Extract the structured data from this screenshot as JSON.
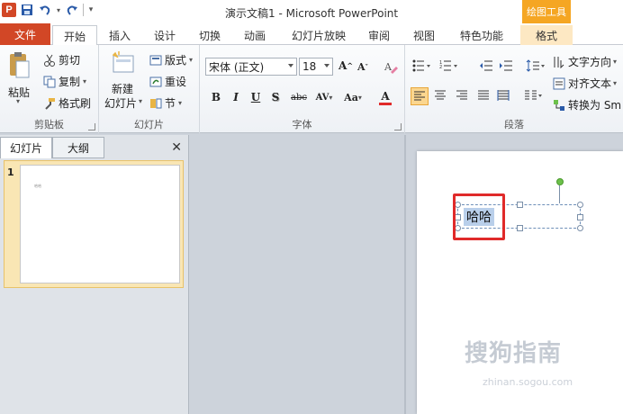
{
  "app": {
    "window_title": "演示文稿1 - Microsoft PowerPoint",
    "context_tools": "绘图工具",
    "app_icon_letter": "P"
  },
  "tabs": [
    {
      "label": "文件"
    },
    {
      "label": "开始"
    },
    {
      "label": "插入"
    },
    {
      "label": "设计"
    },
    {
      "label": "切换"
    },
    {
      "label": "动画"
    },
    {
      "label": "幻灯片放映"
    },
    {
      "label": "审阅"
    },
    {
      "label": "视图"
    },
    {
      "label": "特色功能"
    },
    {
      "label": "格式"
    }
  ],
  "ribbon": {
    "clipboard": {
      "paste": "粘贴",
      "cut": "剪切",
      "copy": "复制",
      "format_painter": "格式刷",
      "label": "剪贴板"
    },
    "slides": {
      "new_line1": "新建",
      "new_line2": "幻灯片",
      "layout": "版式",
      "reset": "重设",
      "section": "节",
      "label": "幻灯片"
    },
    "font": {
      "font_name": "宋体 (正文)",
      "font_size": "18",
      "grow": "A",
      "shrink": "A",
      "bold": "B",
      "italic": "I",
      "underline": "U",
      "shadow": "S",
      "strike": "abc",
      "spacing": "AV",
      "case": "Aa",
      "color": "A",
      "label": "字体"
    },
    "paragraph": {
      "text_direction": "文字方向",
      "align_text": "对齐文本",
      "convert_smartart": "转换为 Sm",
      "label": "段落"
    }
  },
  "panel": {
    "tab_slides": "幻灯片",
    "tab_outline": "大纲",
    "close": "✕",
    "slide_number": "1"
  },
  "slide": {
    "text": "哈哈"
  },
  "watermark": {
    "text": "搜狗指南",
    "url": "zhinan.sogou.com"
  }
}
